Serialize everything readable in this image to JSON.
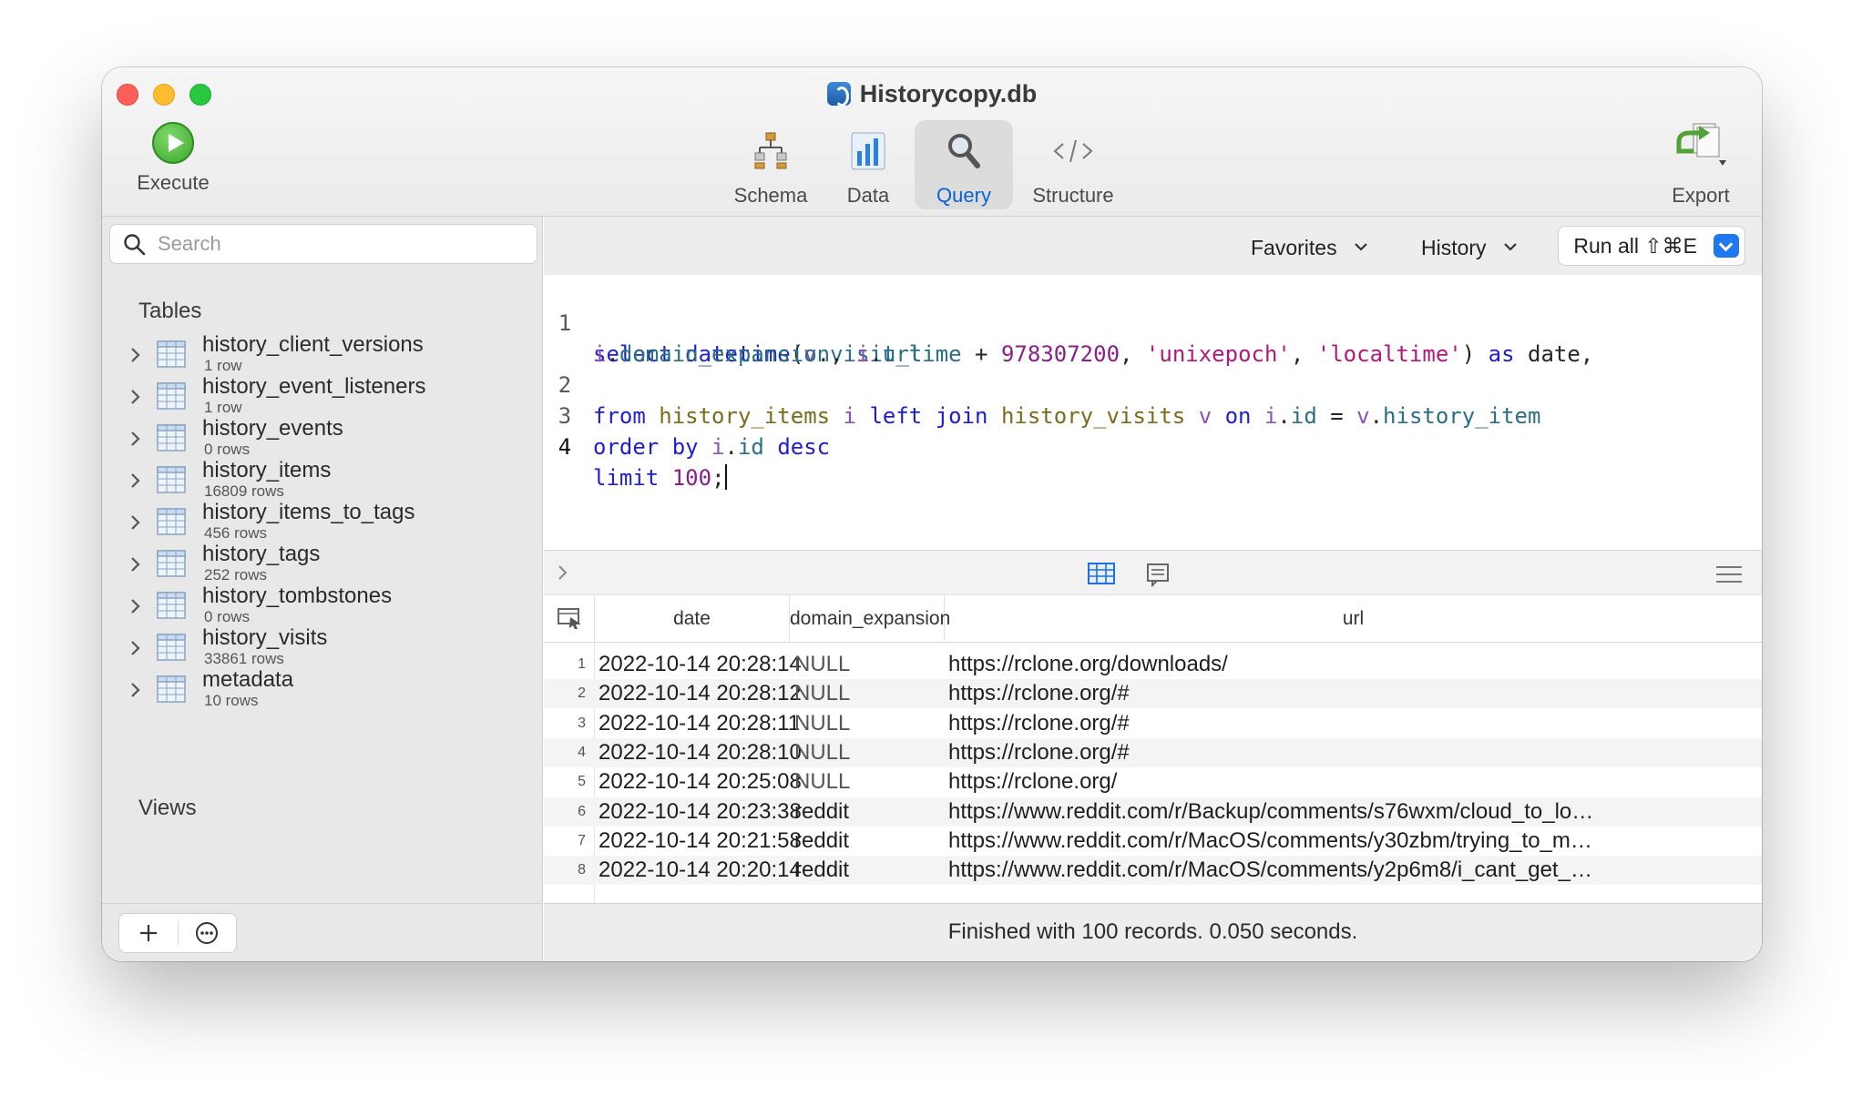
{
  "window": {
    "title": "Historycopy.db"
  },
  "toolbar": {
    "execute_label": "Execute",
    "tabs": [
      {
        "label": "Schema",
        "icon": "schema-icon",
        "active": false
      },
      {
        "label": "Data",
        "icon": "bar-chart-icon",
        "active": false
      },
      {
        "label": "Query",
        "icon": "magnifier-icon",
        "active": true
      },
      {
        "label": "Structure",
        "icon": "code-brackets-icon",
        "active": false
      }
    ],
    "export_label": "Export",
    "accent_color": "#0a63d6"
  },
  "sidebar": {
    "search_placeholder": "Search",
    "tables_heading": "Tables",
    "views_heading": "Views",
    "tables": [
      {
        "name": "history_client_versions",
        "rows": "1 row"
      },
      {
        "name": "history_event_listeners",
        "rows": "1 row"
      },
      {
        "name": "history_events",
        "rows": "0 rows"
      },
      {
        "name": "history_items",
        "rows": "16809 rows"
      },
      {
        "name": "history_items_to_tags",
        "rows": "456 rows"
      },
      {
        "name": "history_tags",
        "rows": "252 rows"
      },
      {
        "name": "history_tombstones",
        "rows": "0 rows"
      },
      {
        "name": "history_visits",
        "rows": "33861 rows"
      },
      {
        "name": "metadata",
        "rows": "10 rows"
      }
    ]
  },
  "query_bar": {
    "favorites_label": "Favorites",
    "history_label": "History",
    "run_all_label": "Run all ⇧⌘E"
  },
  "editor": {
    "line_numbers": [
      "1",
      "2",
      "3",
      "4"
    ],
    "lines": [
      "select datetime(v.visit_time + 978307200, 'unixepoch', 'localtime') as date,",
      "i.domain_expansion, i.url",
      "from history_items i left join history_visits v on i.id = v.history_item",
      "order by i.id desc",
      "limit 100;"
    ]
  },
  "results": {
    "columns": [
      "date",
      "domain_expansion",
      "url"
    ],
    "rows": [
      {
        "n": "1",
        "date": "2022-10-14 20:28:14",
        "domain_expansion": "NULL",
        "url": "https://rclone.org/downloads/"
      },
      {
        "n": "2",
        "date": "2022-10-14 20:28:12",
        "domain_expansion": "NULL",
        "url": "https://rclone.org/#"
      },
      {
        "n": "3",
        "date": "2022-10-14 20:28:11",
        "domain_expansion": "NULL",
        "url": "https://rclone.org/#"
      },
      {
        "n": "4",
        "date": "2022-10-14 20:28:10",
        "domain_expansion": "NULL",
        "url": "https://rclone.org/#"
      },
      {
        "n": "5",
        "date": "2022-10-14 20:25:08",
        "domain_expansion": "NULL",
        "url": "https://rclone.org/"
      },
      {
        "n": "6",
        "date": "2022-10-14 20:23:38",
        "domain_expansion": "reddit",
        "url": "https://www.reddit.com/r/Backup/comments/s76wxm/cloud_to_lo…"
      },
      {
        "n": "7",
        "date": "2022-10-14 20:21:58",
        "domain_expansion": "reddit",
        "url": "https://www.reddit.com/r/MacOS/comments/y30zbm/trying_to_m…"
      },
      {
        "n": "8",
        "date": "2022-10-14 20:20:14",
        "domain_expansion": "reddit",
        "url": "https://www.reddit.com/r/MacOS/comments/y2p6m8/i_cant_get_…"
      }
    ],
    "status": "Finished with 100 records. 0.050 seconds."
  }
}
